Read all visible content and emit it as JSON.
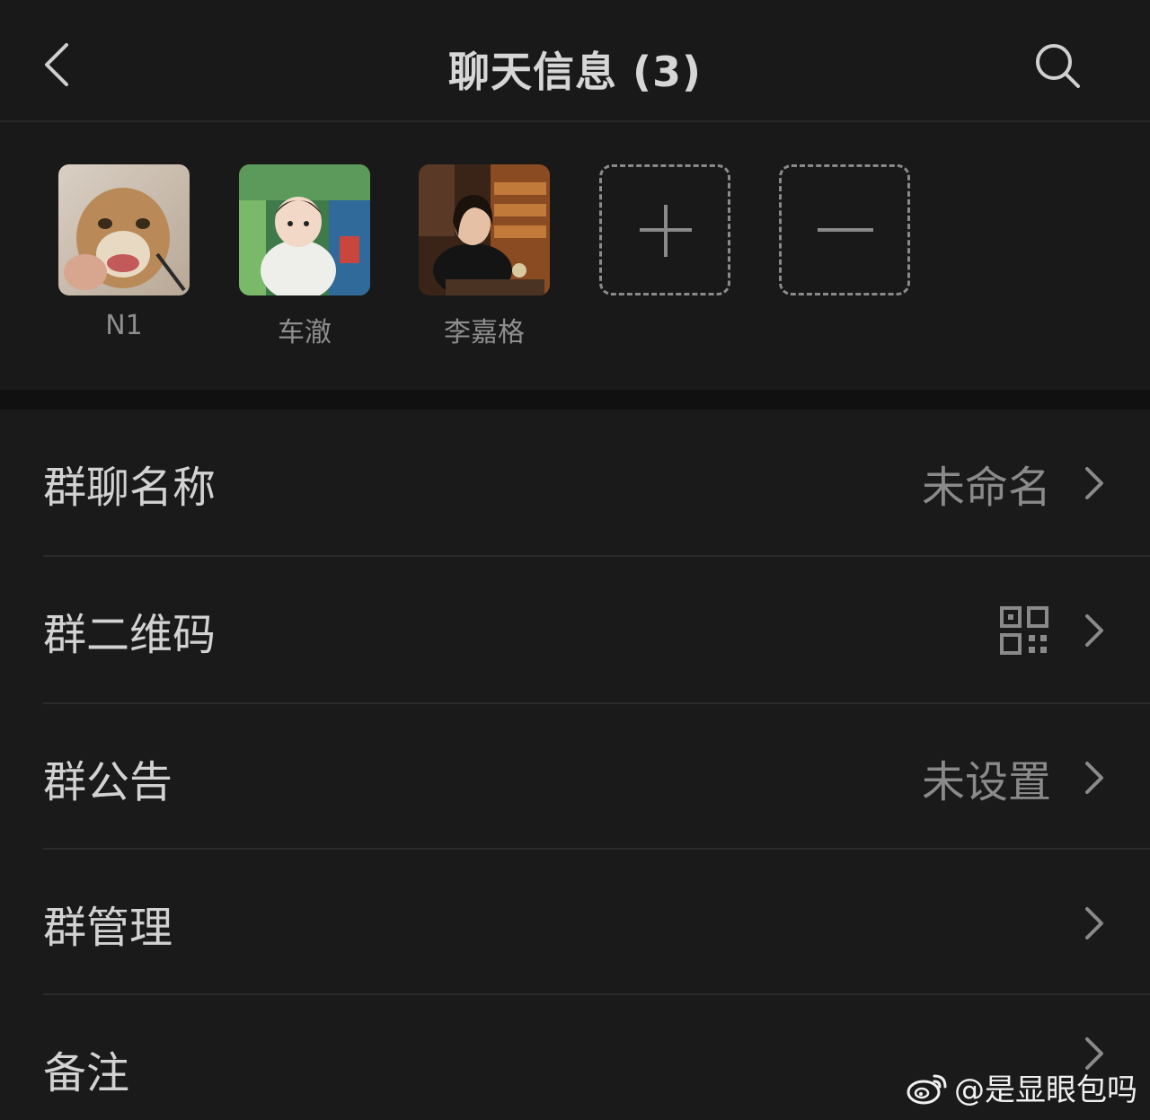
{
  "header": {
    "title": "聊天信息 (3)"
  },
  "members": [
    {
      "name": "N1"
    },
    {
      "name": "车澈"
    },
    {
      "name": "李嘉格"
    }
  ],
  "settings": [
    {
      "label": "群聊名称",
      "value": "未命名"
    },
    {
      "label": "群二维码",
      "value": ""
    },
    {
      "label": "群公告",
      "value": "未设置"
    },
    {
      "label": "群管理",
      "value": ""
    },
    {
      "label": "备注",
      "value": ""
    }
  ],
  "watermark": {
    "text": "@是显眼包吗"
  },
  "colors": {
    "background": "#1a1a1a",
    "header_bg": "#191919",
    "primary_text": "#d2d2d2",
    "secondary_text": "#8a8a8a"
  }
}
